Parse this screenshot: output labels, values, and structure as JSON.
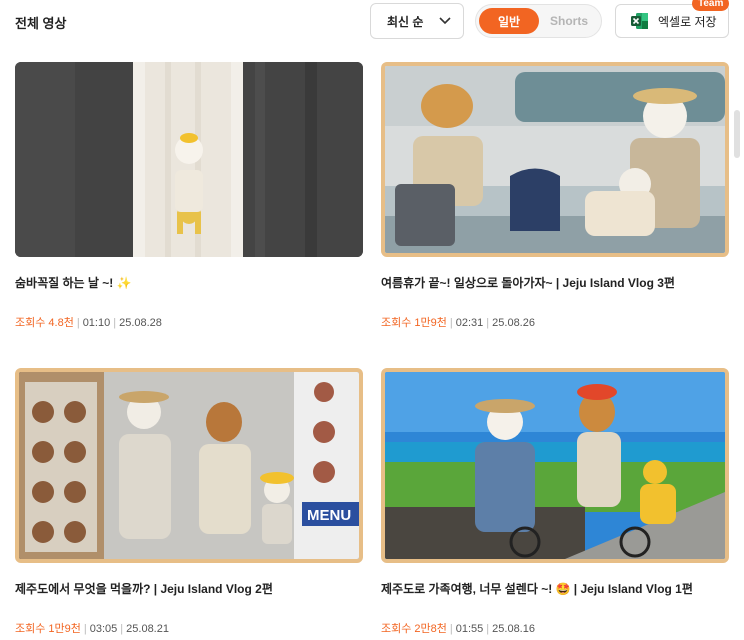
{
  "header": {
    "title": "전체 영상",
    "sort_label": "최신 순",
    "toggle_active": "일반",
    "toggle_inactive": "Shorts",
    "excel_label": "엑셀로 저장",
    "team_badge": "Team"
  },
  "videos": [
    {
      "title": "숨바꼭질 하는 날 ~!",
      "title_emoji": "✨",
      "views": "조회수 4.8천",
      "duration": "01:10",
      "date": "25.08.28"
    },
    {
      "title": "여름휴가 끝~! 일상으로 돌아가자~ | Jeju Island Vlog 3편",
      "views": "조회수 1만9천",
      "duration": "02:31",
      "date": "25.08.26"
    },
    {
      "title": "제주도에서 무엇을 먹을까? | Jeju Island Vlog 2편",
      "views": "조회수 1만9천",
      "duration": "03:05",
      "date": "25.08.21"
    },
    {
      "title": "제주도로 가족여행, 너무 설렌다 ~! 🤩 | Jeju Island Vlog 1편",
      "views": "조회수 2만8천",
      "duration": "01:55",
      "date": "25.08.16"
    }
  ],
  "thumb_sign": "MENU",
  "colors": {
    "accent": "#f26522",
    "frame": "#e7be87",
    "excel_green": "#1f7a44"
  },
  "icons": {
    "sort": "chevron-down-icon",
    "excel": "excel-icon"
  }
}
